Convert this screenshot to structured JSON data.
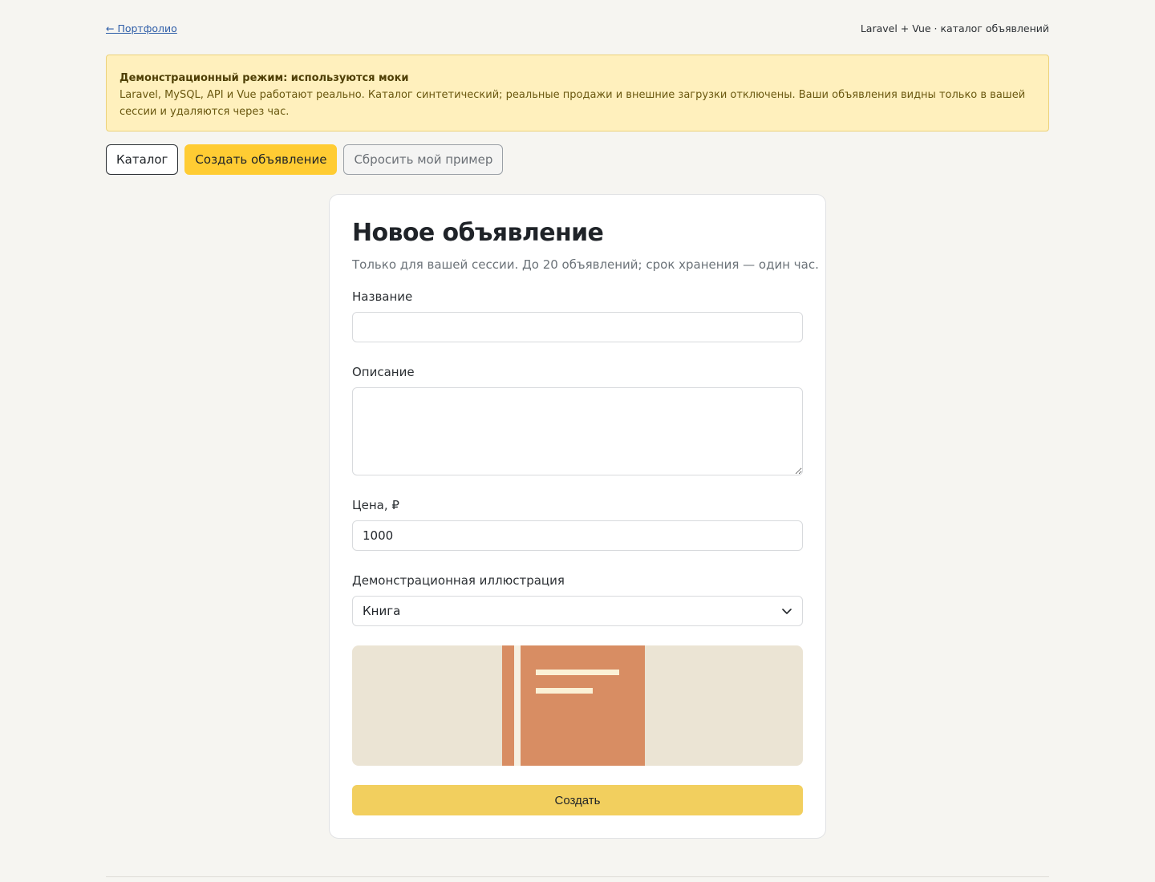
{
  "topbar": {
    "back_link": "← Портфолио",
    "app_caption": "Laravel + Vue · каталог объявлений"
  },
  "notice": {
    "title": "Демонстрационный режим: используются моки",
    "text": "Laravel, MySQL, API и Vue работают реально. Каталог синтетический; реальные продажи и внешние загрузки отключены. Ваши объявления видны только в вашей сессии и удаляются через час."
  },
  "actions": {
    "catalog": "Каталог",
    "create": "Создать объявление",
    "reset": "Сбросить мой пример"
  },
  "form": {
    "title": "Новое объявление",
    "subtitle": "Только для вашей сессии. До 20 объявлений; срок хранения — один час.",
    "name_label": "Название",
    "name_value": "",
    "description_label": "Описание",
    "description_value": "",
    "price_label": "Цена, ₽",
    "price_value": "1000",
    "illustration_label": "Демонстрационная иллюстрация",
    "illustration_selected": "Книга",
    "illustration_icon": "book-illustration",
    "submit": "Создать"
  },
  "colors": {
    "accent": "#ffcc33",
    "submit": "#f2cf5e",
    "notice_bg": "#fff0bd",
    "preview_bg": "#ebe4d4",
    "book": "#d88d63"
  }
}
